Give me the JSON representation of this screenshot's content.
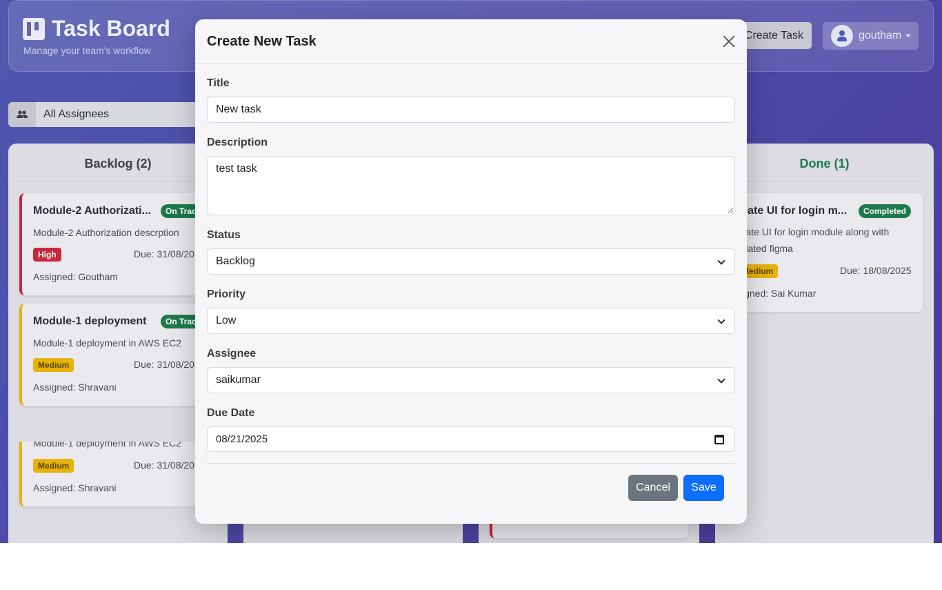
{
  "header": {
    "title": "Task Board",
    "subtitle": "Manage your team's workflow",
    "create_label": "Create Task",
    "username": "goutham"
  },
  "filter": {
    "label": "All Assignees"
  },
  "columns": {
    "backlog": {
      "title": "Backlog (2)",
      "cards": [
        {
          "title": "Module-2 Authorizati...",
          "badge": "On Trac",
          "description": "Module-2 Authorization descrption",
          "priority": "High",
          "due": "Due: 31/08/20",
          "assigned": "Assigned: Goutham"
        },
        {
          "title": "Module-1 deployment",
          "badge": "On Trac",
          "description": "Module-1 deployment in AWS EC2",
          "priority": "Medium",
          "due": "Due: 31/08/20",
          "assigned": "Assigned: Shravani"
        },
        {
          "description": "Module-1 deployment in AWS EC2",
          "priority": "Medium",
          "due": "Due: 31/08/20",
          "assigned": "Assigned: Shravani"
        }
      ]
    },
    "done": {
      "title": "Done (1)",
      "cards": [
        {
          "title": "reate UI for login m...",
          "badge": "Completed",
          "description_line1": "reate UI for login module along with",
          "description_line2": "odated figma",
          "priority": "Medium",
          "due": "Due: 18/08/2025",
          "assigned": "signed: Sai Kumar"
        }
      ]
    }
  },
  "modal": {
    "title": "Create New Task",
    "fields": {
      "title_label": "Title",
      "title_value": "New task",
      "description_label": "Description",
      "description_value": "test task",
      "status_label": "Status",
      "status_value": "Backlog",
      "priority_label": "Priority",
      "priority_value": "Low",
      "assignee_label": "Assignee",
      "assignee_value": "saikumar",
      "due_label": "Due Date",
      "due_value": "08/21/2025"
    },
    "cancel_label": "Cancel",
    "save_label": "Save"
  },
  "colors": {
    "primary": "#0d6efd",
    "secondary": "#6c757d",
    "high": "#c8273a",
    "medium": "#e8b20c",
    "success": "#1d7a4c"
  }
}
